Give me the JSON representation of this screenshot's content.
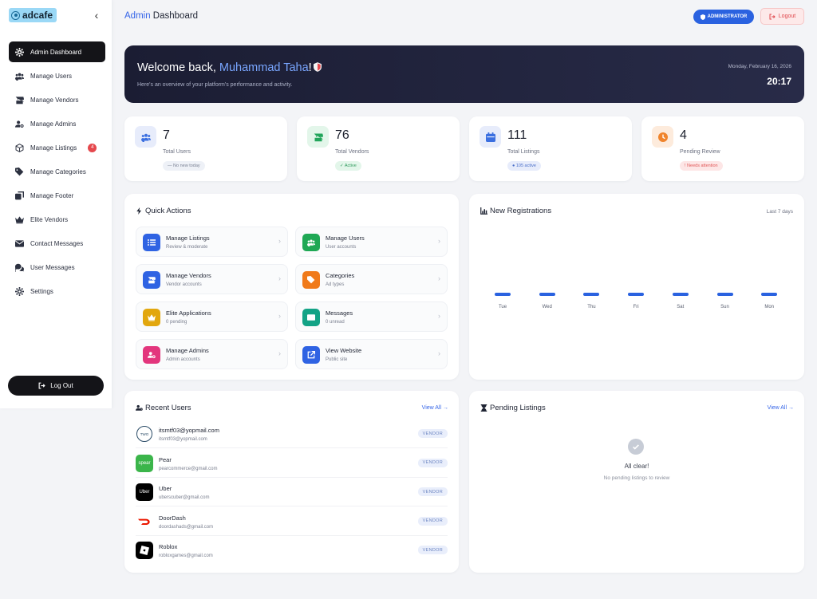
{
  "brand": {
    "name": "adcafe"
  },
  "sidebar": {
    "items": [
      {
        "label": "Admin Dashboard",
        "icon": "gear-icon",
        "active": true
      },
      {
        "label": "Manage Users",
        "icon": "users-icon"
      },
      {
        "label": "Manage Vendors",
        "icon": "store-icon"
      },
      {
        "label": "Manage Admins",
        "icon": "user-gear-icon"
      },
      {
        "label": "Manage Listings",
        "icon": "box-icon",
        "badge": "4"
      },
      {
        "label": "Manage Categories",
        "icon": "tags-icon"
      },
      {
        "label": "Manage Footer",
        "icon": "clone-icon"
      },
      {
        "label": "Elite Vendors",
        "icon": "crown-icon"
      },
      {
        "label": "Contact Messages",
        "icon": "envelope-icon"
      },
      {
        "label": "User Messages",
        "icon": "comments-icon"
      },
      {
        "label": "Settings",
        "icon": "gear-icon"
      }
    ],
    "logout_label": "Log Out"
  },
  "header": {
    "title_highlight": "Admin",
    "title_rest": " Dashboard",
    "role_label": "ADMINISTRATOR",
    "logout_label": "Logout"
  },
  "welcome": {
    "greeting": "Welcome back, ",
    "name": "Muhammad Taha",
    "exclaim": "!",
    "subtitle": "Here's an overview of your platform's performance and activity.",
    "date": "Monday, February 16, 2026",
    "time": "20:17"
  },
  "stats": [
    {
      "value": "7",
      "label": "Total Users",
      "chip": "— No new today",
      "icon": "users-icon",
      "color": "#3b6fe0",
      "bg": "#e7ecfb",
      "chip_bg": "#eef1f7",
      "chip_fg": "#7a8193"
    },
    {
      "value": "76",
      "label": "Total Vendors",
      "chip": "✓ Active",
      "icon": "store-icon",
      "color": "#22a55b",
      "bg": "#e3f6ea",
      "chip_bg": "#e3f6ea",
      "chip_fg": "#2e9a5c"
    },
    {
      "value": "111",
      "label": "Total Listings",
      "chip": "● 105 active",
      "icon": "calendar-icon",
      "color": "#3b6fe0",
      "bg": "#e7ecfb",
      "chip_bg": "#e7ecfb",
      "chip_fg": "#4a6fc9"
    },
    {
      "value": "4",
      "label": "Pending Review",
      "chip": "! Needs attention",
      "icon": "clock-icon",
      "color": "#f0842c",
      "bg": "#fdebdc",
      "chip_bg": "#fde6e6",
      "chip_fg": "#e05656"
    }
  ],
  "quick_actions": {
    "title": "Quick Actions",
    "items": [
      {
        "title": "Manage Listings",
        "sub": "Review & moderate",
        "icon": "list-icon",
        "color": "#2f63e3"
      },
      {
        "title": "Manage Users",
        "sub": "User accounts",
        "icon": "users-icon",
        "color": "#1fa855"
      },
      {
        "title": "Manage Vendors",
        "sub": "Vendor accounts",
        "icon": "store-icon",
        "color": "#2f63e3"
      },
      {
        "title": "Categories",
        "sub": "Ad types",
        "icon": "tags-icon",
        "color": "#f07a1a"
      },
      {
        "title": "Elite Applications",
        "sub": "0 pending",
        "icon": "crown-icon",
        "color": "#e2a70e"
      },
      {
        "title": "Messages",
        "sub": "0 unread",
        "icon": "envelope-icon",
        "color": "#13a386"
      },
      {
        "title": "Manage Admins",
        "sub": "Admin accounts",
        "icon": "user-gear-icon",
        "color": "#e3367d"
      },
      {
        "title": "View Website",
        "sub": "Public site",
        "icon": "external-link-icon",
        "color": "#2f63e3"
      }
    ]
  },
  "registrations": {
    "title": "New Registrations",
    "range": "Last 7 days",
    "days": [
      "Tue",
      "Wed",
      "Thu",
      "Fri",
      "Sat",
      "Sun",
      "Mon"
    ],
    "counts": [
      0,
      0,
      0,
      0,
      0,
      0,
      0
    ]
  },
  "recent_users": {
    "title": "Recent Users",
    "view_all": "View All →",
    "rows": [
      {
        "name": "itsmtf03@yopmail.com",
        "email": "itsmtf03@yopmail.com",
        "role": "VENDOR",
        "avatar_text": "TWO",
        "avatar_bg": "#ffffff",
        "avatar_fg": "#2a4b66"
      },
      {
        "name": "Pear",
        "email": "pearcommerce@gmail.com",
        "role": "VENDOR",
        "avatar_text": "spear",
        "avatar_bg": "#3bb54a",
        "avatar_fg": "#ffffff"
      },
      {
        "name": "Uber",
        "email": "uberscuber@gmail.com",
        "role": "VENDOR",
        "avatar_text": "Uber",
        "avatar_bg": "#000000",
        "avatar_fg": "#ffffff"
      },
      {
        "name": "DoorDash",
        "email": "doordashads@gmail.com",
        "role": "VENDOR",
        "avatar_text": "",
        "avatar_bg": "#ffffff",
        "avatar_fg": "#eb1700"
      },
      {
        "name": "Roblox",
        "email": "robloxgames@gmail.com",
        "role": "VENDOR",
        "avatar_text": "",
        "avatar_bg": "#000000",
        "avatar_fg": "#ffffff"
      }
    ]
  },
  "pending_listings": {
    "title": "Pending Listings",
    "view_all": "View All →",
    "empty_title": "All clear!",
    "empty_sub": "No pending listings to review"
  }
}
